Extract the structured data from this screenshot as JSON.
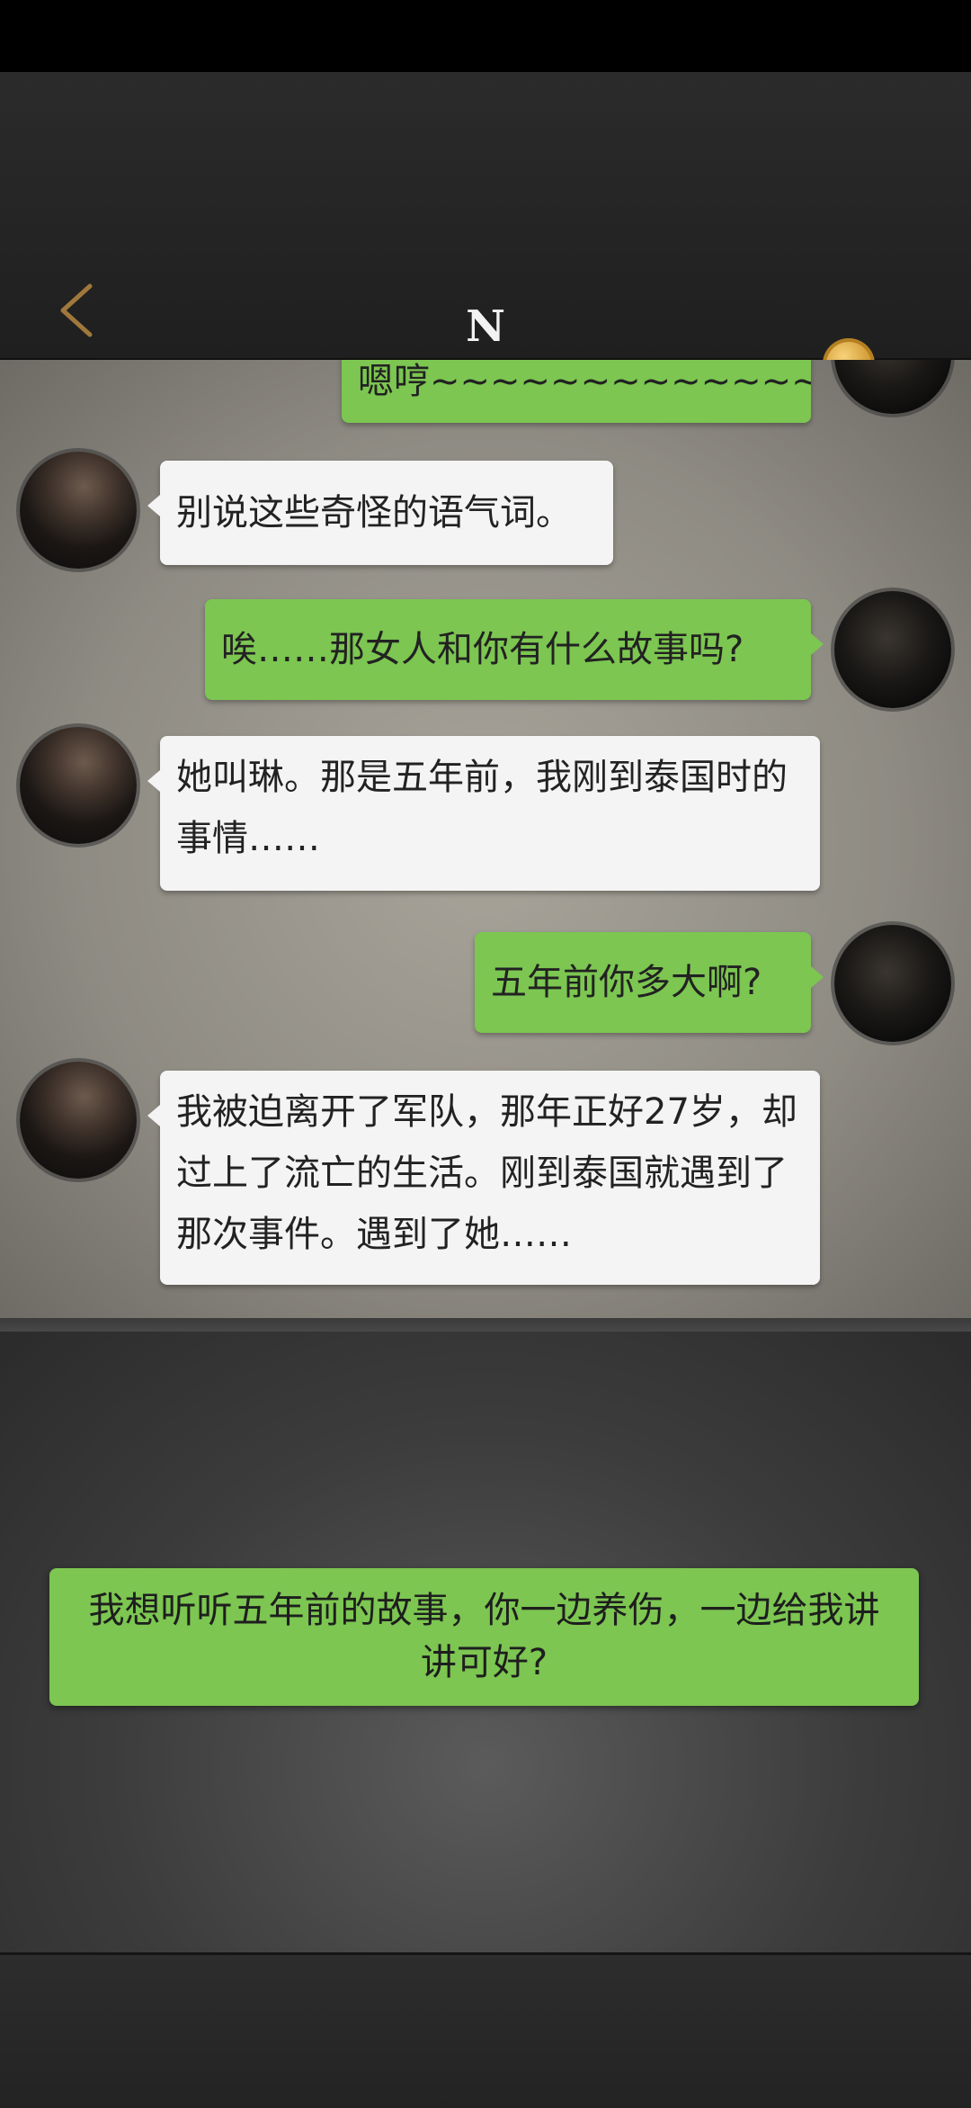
{
  "header": {
    "title": "N",
    "back_icon": "chevron-left-icon",
    "coin_icon": "infinity-coin-icon",
    "coin_symbol": "∞"
  },
  "colors": {
    "accent_green": "#7cc651",
    "bubble_white": "#f4f4f4",
    "back_arrow": "#a0783c",
    "coin_gold": "#e2a53a"
  },
  "messages": [
    {
      "sender": "me",
      "text": "嗯哼~~~~~~~~~~~~~~~~~~"
    },
    {
      "sender": "him",
      "text": "别说这些奇怪的语气词。"
    },
    {
      "sender": "me",
      "text": "唉……那女人和你有什么故事吗?"
    },
    {
      "sender": "him",
      "text": "她叫琳。那是五年前，我刚到泰国时的事情……"
    },
    {
      "sender": "me",
      "text": "五年前你多大啊?"
    },
    {
      "sender": "him",
      "text": "我被迫离开了军队，那年正好27岁，却过上了流亡的生活。刚到泰国就遇到了那次事件。遇到了她……"
    }
  ],
  "choice": {
    "text": "我想听听五年前的故事，你一边养伤，一边给我讲讲可好?"
  }
}
